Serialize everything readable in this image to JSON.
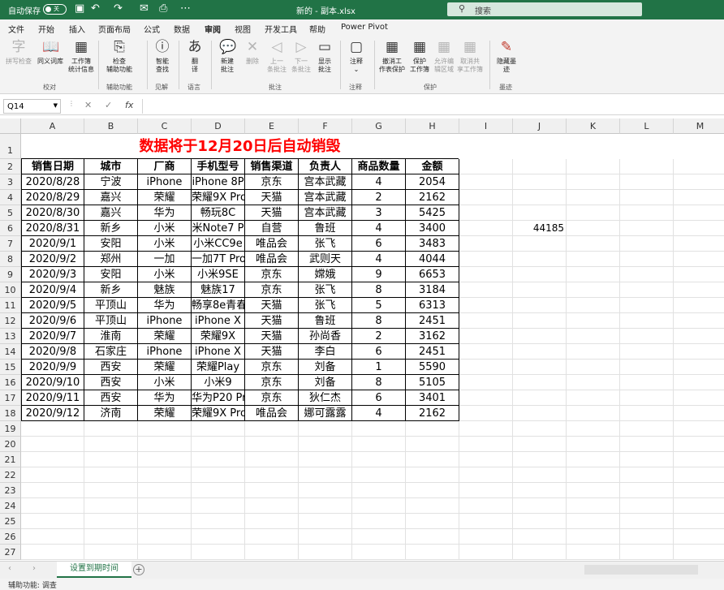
{
  "titlebar": {
    "autosave_label": "自动保存",
    "autosave_state": "关",
    "doc_title": "新的 - 副本.xlsx",
    "search_placeholder": "搜索",
    "qa_icons": [
      "save-icon",
      "undo-icon",
      "redo-icon",
      "email-icon",
      "print-icon",
      "more-icon"
    ]
  },
  "menu": {
    "tabs": [
      "文件",
      "开始",
      "插入",
      "页面布局",
      "公式",
      "数据",
      "审阅",
      "视图",
      "开发工具",
      "帮助",
      "Power Pivot"
    ],
    "active": "审阅"
  },
  "ribbon": {
    "groups": [
      {
        "name": "校对",
        "buttons": [
          {
            "label": "拼写检查",
            "disabled": true
          },
          {
            "label": "同义词库"
          },
          {
            "label": "工作簿\n统计信息"
          }
        ]
      },
      {
        "name": "辅助功能",
        "buttons": [
          {
            "label": "检查\n辅助功能"
          }
        ]
      },
      {
        "name": "见解",
        "buttons": [
          {
            "label": "智能\n查找"
          }
        ]
      },
      {
        "name": "语言",
        "buttons": [
          {
            "label": "翻\n译"
          }
        ]
      },
      {
        "name": "批注",
        "buttons": [
          {
            "label": "新建\n批注"
          },
          {
            "label": "删除",
            "disabled": true
          },
          {
            "label": "上一\n条批注",
            "disabled": true
          },
          {
            "label": "下一\n条批注",
            "disabled": true
          },
          {
            "label": "显示\n批注"
          }
        ]
      },
      {
        "name": "注释",
        "buttons": [
          {
            "label": "注释"
          }
        ]
      },
      {
        "name": "保护",
        "buttons": [
          {
            "label": "撤消工\n作表保护"
          },
          {
            "label": "保护\n工作簿"
          },
          {
            "label": "允许编\n辑区域",
            "disabled": true
          },
          {
            "label": "取消共\n享工作簿",
            "disabled": true
          }
        ]
      },
      {
        "name": "墨迹",
        "buttons": [
          {
            "label": "隐藏墨\n迹"
          }
        ]
      }
    ]
  },
  "formula_bar": {
    "name_box": "Q14",
    "content": ""
  },
  "grid": {
    "columns": [
      "A",
      "B",
      "C",
      "D",
      "E",
      "F",
      "G",
      "H",
      "I",
      "J",
      "K",
      "L",
      "M"
    ],
    "rows": [
      "1",
      "2",
      "3",
      "4",
      "5",
      "6",
      "7",
      "8",
      "9",
      "10",
      "11",
      "12",
      "13",
      "14",
      "15",
      "16",
      "17",
      "18",
      "19",
      "20",
      "21",
      "22",
      "23",
      "24",
      "25",
      "26",
      "27"
    ],
    "title": "数据将于12月20日后自动销毁",
    "headers": [
      "销售日期",
      "城市",
      "厂商",
      "手机型号",
      "销售渠道",
      "负责人",
      "商品数量",
      "金额"
    ],
    "data": [
      [
        "2020/8/28",
        "宁波",
        "iPhone",
        "iPhone 8P",
        "京东",
        "宫本武藏",
        "4",
        "2054"
      ],
      [
        "2020/8/29",
        "嘉兴",
        "荣耀",
        "荣耀9X Pro",
        "天猫",
        "宫本武藏",
        "2",
        "2162"
      ],
      [
        "2020/8/30",
        "嘉兴",
        "华为",
        "畅玩8C",
        "天猫",
        "宫本武藏",
        "3",
        "5425"
      ],
      [
        "2020/8/31",
        "新乡",
        "小米",
        "米Note7 P",
        "自营",
        "鲁班",
        "4",
        "3400"
      ],
      [
        "2020/9/1",
        "安阳",
        "小米",
        "小米CC9e",
        "唯品会",
        "张飞",
        "6",
        "3483"
      ],
      [
        "2020/9/2",
        "郑州",
        "一加",
        "一加7T Pro",
        "唯品会",
        "武则天",
        "4",
        "4044"
      ],
      [
        "2020/9/3",
        "安阳",
        "小米",
        "小米9SE",
        "京东",
        "嫦娥",
        "9",
        "6653"
      ],
      [
        "2020/9/4",
        "新乡",
        "魅族",
        "魅族17",
        "京东",
        "张飞",
        "8",
        "3184"
      ],
      [
        "2020/9/5",
        "平顶山",
        "华为",
        "畅享8e青春",
        "天猫",
        "张飞",
        "5",
        "6313"
      ],
      [
        "2020/9/6",
        "平顶山",
        "iPhone",
        "iPhone X",
        "天猫",
        "鲁班",
        "8",
        "2451"
      ],
      [
        "2020/9/7",
        "淮南",
        "荣耀",
        "荣耀9X",
        "天猫",
        "孙尚香",
        "2",
        "3162"
      ],
      [
        "2020/9/8",
        "石家庄",
        "iPhone",
        "iPhone X",
        "天猫",
        "李白",
        "6",
        "2451"
      ],
      [
        "2020/9/9",
        "西安",
        "荣耀",
        "荣耀Play",
        "京东",
        "刘备",
        "1",
        "5590"
      ],
      [
        "2020/9/10",
        "西安",
        "小米",
        "小米9",
        "京东",
        "刘备",
        "8",
        "5105"
      ],
      [
        "2020/9/11",
        "西安",
        "华为",
        "华为P20 Pro",
        "京东",
        "狄仁杰",
        "6",
        "3401"
      ],
      [
        "2020/9/12",
        "济南",
        "荣耀",
        "荣耀9X Pro",
        "唯品会",
        "娜可露露",
        "4",
        "2162"
      ]
    ],
    "extra_cell": {
      "ref": "J6",
      "value": "44185"
    }
  },
  "sheets": {
    "tabs": [
      "设置到期时间"
    ],
    "active": "设置到期时间"
  },
  "status": {
    "accessibility": "辅助功能: 调查"
  }
}
